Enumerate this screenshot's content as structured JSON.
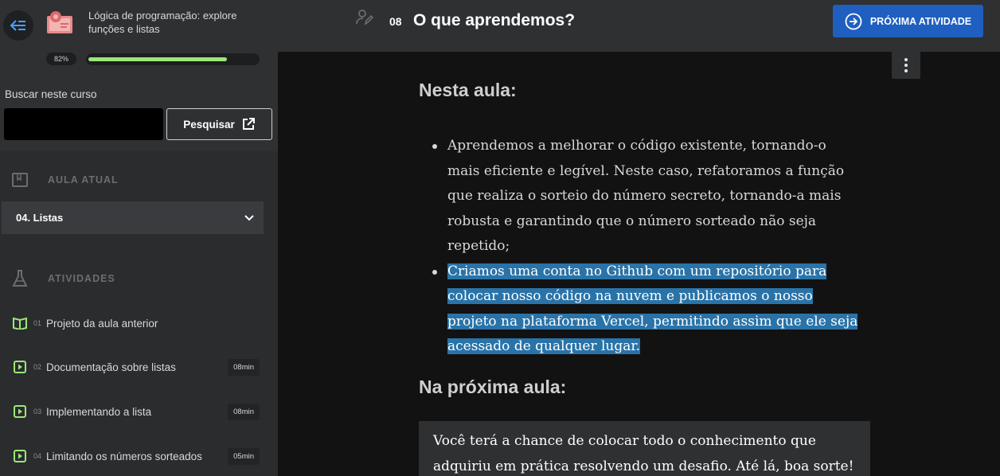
{
  "course": {
    "title": "Lógica de programação: explore funções e listas",
    "progress_label": "82%",
    "progress": 0.82
  },
  "search": {
    "label": "Buscar neste curso",
    "value": "",
    "button_label": "Pesquisar"
  },
  "current_lesson": {
    "heading": "AULA ATUAL",
    "selected": "04. Listas"
  },
  "activities": {
    "heading": "ATIVIDADES",
    "items": [
      {
        "num": "01",
        "label": "Projeto da aula anterior",
        "duration": "",
        "icon": "book-icon"
      },
      {
        "num": "02",
        "label": "Documentação sobre listas",
        "duration": "08min",
        "icon": "play-icon"
      },
      {
        "num": "03",
        "label": "Implementando a lista",
        "duration": "08min",
        "icon": "play-icon"
      },
      {
        "num": "04",
        "label": "Limitando os números sorteados",
        "duration": "05min",
        "icon": "play-icon"
      }
    ]
  },
  "header": {
    "lesson_number": "08",
    "lesson_title": "O que aprendemos?",
    "next_button": "PRÓXIMA ATIVIDADE"
  },
  "content": {
    "section1_title": "Nesta aula:",
    "bullet1": "Aprendemos a melhorar o código existente, tornando-o mais eficiente e legível. Neste caso, refatoramos a função que realiza o sorteio do número secreto, tornando-a mais robusta e garantindo que o número sorteado não seja repetido;",
    "bullet2": "Criamos uma conta no Github com um repositório para colocar nosso código na nuvem e publicamos o nosso projeto na plataforma Vercel, permitindo assim que ele seja acessado de qualquer lugar.",
    "section2_title": "Na próxima aula:",
    "callout": "Você terá a chance de colocar todo o conhecimento que adquiriu em prática resolvendo um desafio. Até lá, boa sorte!"
  },
  "colors": {
    "accent": "#1f5fbf",
    "progress": "#9be779",
    "highlight": "#2a73a8"
  }
}
